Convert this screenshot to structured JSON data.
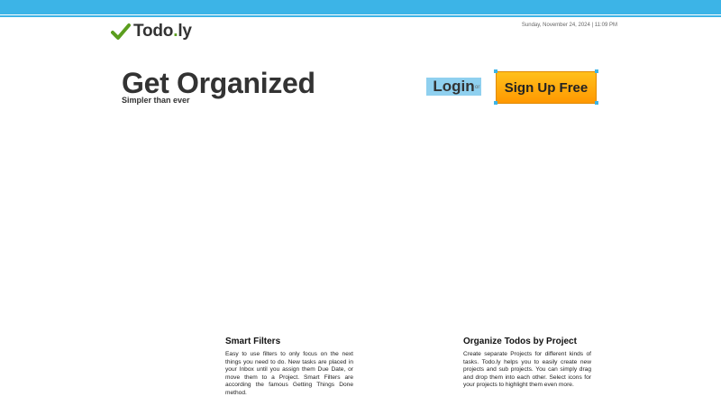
{
  "header": {
    "logo_name": "Todo",
    "logo_dot": ".",
    "logo_suffix": "ly",
    "logo_icon": "checkmark-icon",
    "datetime": "Sunday, November 24, 2024 | 11:09 PM",
    "brand_color": "#3cb4e7"
  },
  "hero": {
    "title": "Get Organized",
    "subtitle": "Simpler than ever",
    "login_label": "Login",
    "or_label": "or",
    "signup_label": "Sign Up Free",
    "signup_color": "#ff9800"
  },
  "features": [
    {
      "title": "Smart Filters",
      "text": "Easy to use filters to only focus on the next things you need to do. New tasks are placed in your Inbox until you assign them Due Date, or move them to a Project. Smart Filters are according the famous Getting Things Done method."
    },
    {
      "title": "Organize Todos by Project",
      "text": "Create separate Projects for different kinds of tasks. Todo.ly helps you to easily create new projects and sub projects. You can simply drag and drop them into each other. Select icons for your projects to highlight them even more."
    }
  ]
}
